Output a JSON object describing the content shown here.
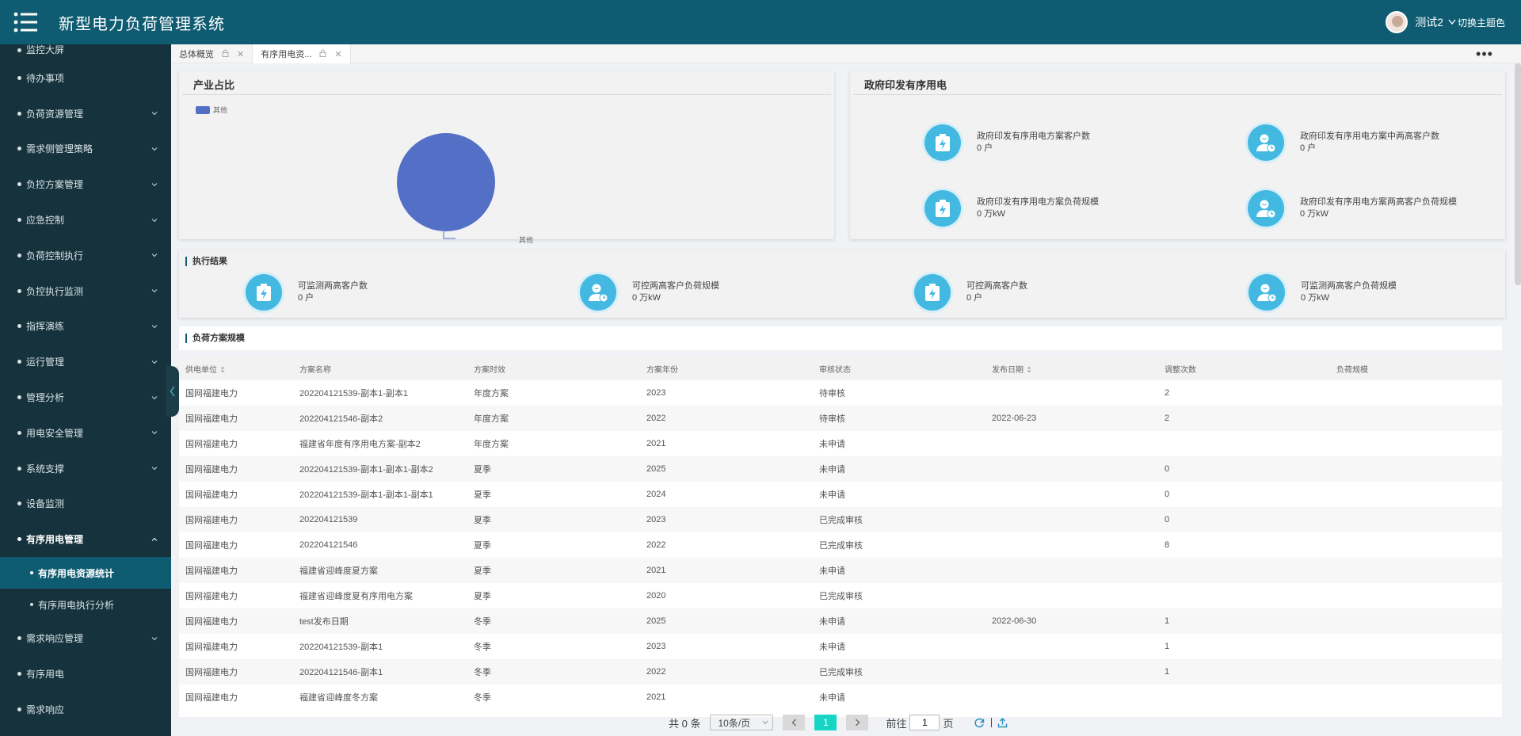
{
  "header": {
    "title": "新型电力负荷管理系统",
    "user_name": "测试2",
    "theme_label": "切换主题色"
  },
  "sidebar": {
    "items": [
      {
        "label": "监控大屏",
        "chevron": false
      },
      {
        "label": "待办事项",
        "chevron": false
      },
      {
        "label": "负荷资源管理",
        "chevron": true
      },
      {
        "label": "需求侧管理策略",
        "chevron": true
      },
      {
        "label": "负控方案管理",
        "chevron": true
      },
      {
        "label": "应急控制",
        "chevron": true
      },
      {
        "label": "负荷控制执行",
        "chevron": true
      },
      {
        "label": "负控执行监测",
        "chevron": true
      },
      {
        "label": "指挥演练",
        "chevron": true
      },
      {
        "label": "运行管理",
        "chevron": true
      },
      {
        "label": "管理分析",
        "chevron": true
      },
      {
        "label": "用电安全管理",
        "chevron": true
      },
      {
        "label": "系统支撑",
        "chevron": true
      },
      {
        "label": "设备监测",
        "chevron": false
      },
      {
        "label": "有序用电管理",
        "chevron": true
      }
    ],
    "sub_items": [
      {
        "label": "有序用电资源统计"
      },
      {
        "label": "有序用电执行分析"
      }
    ],
    "tail_items": [
      {
        "label": "需求响应管理",
        "chevron": true
      },
      {
        "label": "有序用电",
        "chevron": false
      },
      {
        "label": "需求响应",
        "chevron": false
      }
    ]
  },
  "tabs": [
    {
      "label": "总体概览"
    },
    {
      "label": "有序用电资..."
    }
  ],
  "industry_card": {
    "title": "产业占比",
    "legend": "其他",
    "slice_label": "其他"
  },
  "chart_data": {
    "type": "pie",
    "title": "产业占比",
    "slices": [
      {
        "label": "其他",
        "value": 100,
        "color": "#5470c6"
      }
    ],
    "legend_position": "top-left"
  },
  "gov_card": {
    "title": "政府印发有序用电",
    "stats": [
      {
        "label": "政府印发有序用电方案客户数",
        "value": "0 户",
        "icon": "battery-icon"
      },
      {
        "label": "政府印发有序用电方案中两高客户数",
        "value": "0 户",
        "icon": "user-clock-icon"
      },
      {
        "label": "政府印发有序用电方案负荷规模",
        "value": "0 万kW",
        "icon": "battery-icon"
      },
      {
        "label": "政府印发有序用电方案两高客户负荷规模",
        "value": "0 万kW",
        "icon": "user-clock-icon"
      }
    ]
  },
  "exec_card": {
    "title": "执行结果",
    "stats": [
      {
        "label": "可监测两高客户数",
        "value": "0 户",
        "icon": "battery-icon"
      },
      {
        "label": "可控两高客户负荷规模",
        "value": "0 万kW",
        "icon": "user-clock-icon"
      },
      {
        "label": "可控两高客户数",
        "value": "0 户",
        "icon": "battery-icon"
      },
      {
        "label": "可监测两高客户负荷规模",
        "value": "0 万kW",
        "icon": "user-clock-icon"
      }
    ]
  },
  "plan_section": {
    "title": "负荷方案规模"
  },
  "table": {
    "columns": [
      "供电单位",
      "方案名称",
      "方案时效",
      "方案年份",
      "审核状态",
      "发布日期",
      "调整次数",
      "负荷规模"
    ],
    "rows": [
      [
        "国网福建电力",
        "202204121539-副本1-副本1",
        "年度方案",
        "2023",
        "待审核",
        "",
        "2",
        ""
      ],
      [
        "国网福建电力",
        "202204121546-副本2",
        "年度方案",
        "2022",
        "待审核",
        "2022-06-23",
        "2",
        ""
      ],
      [
        "国网福建电力",
        "福建省年度有序用电方案-副本2",
        "年度方案",
        "2021",
        "未申请",
        "",
        "",
        ""
      ],
      [
        "国网福建电力",
        "202204121539-副本1-副本1-副本2",
        "夏季",
        "2025",
        "未申请",
        "",
        "0",
        ""
      ],
      [
        "国网福建电力",
        "202204121539-副本1-副本1-副本1",
        "夏季",
        "2024",
        "未申请",
        "",
        "0",
        ""
      ],
      [
        "国网福建电力",
        "202204121539",
        "夏季",
        "2023",
        "已完成审核",
        "",
        "0",
        ""
      ],
      [
        "国网福建电力",
        "202204121546",
        "夏季",
        "2022",
        "已完成审核",
        "",
        "8",
        ""
      ],
      [
        "国网福建电力",
        "福建省迎峰度夏方案",
        "夏季",
        "2021",
        "未申请",
        "",
        "",
        ""
      ],
      [
        "国网福建电力",
        "福建省迎峰度夏有序用电方案",
        "夏季",
        "2020",
        "已完成审核",
        "",
        "",
        ""
      ],
      [
        "国网福建电力",
        "test发布日期",
        "冬季",
        "2025",
        "未申请",
        "2022-06-30",
        "1",
        ""
      ],
      [
        "国网福建电力",
        "202204121539-副本1",
        "冬季",
        "2023",
        "未申请",
        "",
        "1",
        ""
      ],
      [
        "国网福建电力",
        "202204121546-副本1",
        "冬季",
        "2022",
        "已完成审核",
        "",
        "1",
        ""
      ],
      [
        "国网福建电力",
        "福建省迎峰度冬方案",
        "冬季",
        "2021",
        "未申请",
        "",
        "",
        ""
      ]
    ]
  },
  "pager": {
    "total": "共 0 条",
    "page_size": "10条/页",
    "current_page": "1",
    "goto_prefix": "前往",
    "goto_value": "1",
    "goto_suffix": "页"
  },
  "colors": {
    "header_bg": "#0f5c72",
    "sidebar_bg": "#16323c",
    "active_item": "#0f5c72",
    "icon_blue": "#43b9e2",
    "pie_blue": "#5470c6",
    "page_active": "#17d5c5"
  }
}
